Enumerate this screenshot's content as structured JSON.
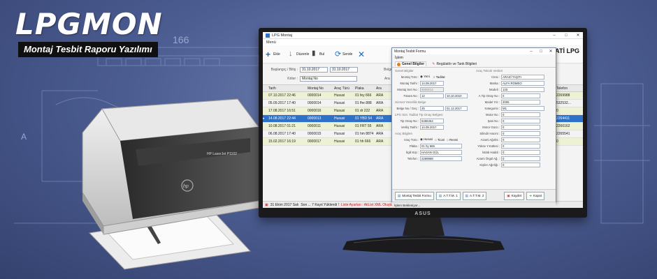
{
  "brand": {
    "title": "LPGMON",
    "subtitle": "Montaj Tesbit Raporu Yazılımı"
  },
  "blueprint": {
    "dimension_label": "166",
    "axis_letter": "A"
  },
  "printer": {
    "model_label": "HP LaserJet P1102",
    "brand_mark": "hp"
  },
  "monitor": {
    "brand_label": "ASUS"
  },
  "app": {
    "window_title": "LPG Montaj",
    "menu_label": "Menü",
    "toolbar": {
      "add_label": "Ekle",
      "edit_label": "Düzenle",
      "find_label": "Bul",
      "send_label": "Sende",
      "brand": "ATİ LPG"
    },
    "filters": {
      "date_label": "Başlangıç / Bitiş :",
      "date_start": "31.10.2017",
      "date_end": "31.10.2017",
      "criteria_label": "Kriter :",
      "criteria_value": "Montaj No",
      "doc_label": "Belge Tür",
      "search_label": "Ara"
    },
    "grid": {
      "headers": [
        "Tarih",
        "Montaj No",
        "Araç Türü",
        "Plaka",
        "Ara",
        "Telefon"
      ],
      "rows": [
        {
          "date": "07.10.2017 22:46",
          "no": "0000014",
          "type": "Hususi",
          "plate": "01 fey 666",
          "extra": "ARA",
          "phone": "2269988",
          "style": "alt"
        },
        {
          "date": "05.09.2017 17:40",
          "no": "0000014",
          "type": "Hususi",
          "plate": "01 fhe 888",
          "extra": "ARA",
          "phone": "532532...",
          "style": ""
        },
        {
          "date": "17.08.2017 16:51",
          "no": "0000016",
          "type": "Hususi",
          "plate": "01 dr 222",
          "extra": "ARA",
          "phone": "0",
          "style": "alt"
        },
        {
          "date": "14.08.2017 22:44",
          "no": "0000013",
          "type": "Hususi",
          "plate": "01 YBD 54",
          "extra": "ARA",
          "phone": "2264411",
          "style": "sel"
        },
        {
          "date": "10.08.2017 01:21",
          "no": "0000011",
          "type": "Hususi",
          "plate": "01 FRT 55",
          "extra": "ARA",
          "phone": "2266162",
          "style": "alt"
        },
        {
          "date": "06.08.2017 17:40",
          "no": "0000015",
          "type": "Hususi",
          "plate": "01 hm 8874",
          "extra": "ARA",
          "phone": "2265541",
          "style": ""
        },
        {
          "date": "15.02.2017 16:19",
          "no": "0000017",
          "type": "Hususi",
          "plate": "01 hh 666",
          "extra": "ARA",
          "phone": "0",
          "style": "alt"
        }
      ]
    },
    "status": {
      "date": "31 Ekim 2017 Salı",
      "records": "Son ... 7 Kayıt Yüklendi !",
      "warning": "Liste Ayarları : AtiList XML Oluşturuldu !"
    }
  },
  "dialog": {
    "title": "Montaj Tesbit Formu",
    "menu_label": "İşlem",
    "tabs": [
      "Genel Bilgiler",
      "Regülatör ve Tank Bilgileri"
    ],
    "general": {
      "group": "Genel Bilgiler",
      "montaj_turu_label": "Montaj Türü :",
      "montaj_turu_opt1": "Yeni",
      "montaj_turu_opt2": "Tadilat",
      "tarih_label": "Montaj Tarihi :",
      "tarih_value": "14.08.2017",
      "seri_no_label": "Montaj Seri No :",
      "seri_no_value": "0000014",
      "fatura_label": "Fatura No :",
      "fatura_value": "12",
      "fatura_date": "10.10.2010",
      "hizmet_group": "Hizmet Yeterlilik Belge",
      "belge_label": "Belge No / Geç :",
      "belge_value": "25",
      "belge_date": "01.12.2017",
      "tip_group": "LPG Sist. Tadilat Tip Onay Belgesi",
      "tip_label": "Tip Onay No :",
      "tip_value": "5456464",
      "verilis_label": "Veriliş Tarihi :",
      "verilis_value": "14.08.2017"
    },
    "vehicle": {
      "group": "Araç Bilgileri",
      "tur_label": "Araç Türü :",
      "tur_opts": [
        "Hususi",
        "Ticari",
        "Resmi"
      ],
      "plaka_label": "Plaka :",
      "plaka_value": "01 hy 666",
      "ilgili_label": "İlgili Kişi :",
      "ilgili_value": "HASAN GÜL",
      "telefon_label": "Telefon :",
      "telefon_value": "2269988"
    },
    "tech": {
      "group": "Araç Teknik Verileri",
      "rows": [
        {
          "label": "Cinsi :",
          "value": "ARAZİ TAŞITI"
        },
        {
          "label": "Marka :",
          "value": "ALFA ROMEO"
        },
        {
          "label": "Modeli :",
          "value": "133"
        },
        {
          "label": "A.Tip Onay No :",
          "value": "0"
        },
        {
          "label": "Model Yılı :",
          "value": "2006"
        },
        {
          "label": "Kategorisi :",
          "value": "M1"
        },
        {
          "label": "Motor No :",
          "value": "0"
        },
        {
          "label": "Şasi No :",
          "value": "0"
        },
        {
          "label": "Motor Gücü :",
          "value": "0"
        },
        {
          "label": "Silindir Hacmi :",
          "value": "0"
        },
        {
          "label": "Azami Ağırlık :",
          "value": "0"
        },
        {
          "label": "Yükse Y.Kütlesi :",
          "value": "0"
        },
        {
          "label": "İstiab Haddi :",
          "value": "0"
        },
        {
          "label": "Azami Örgül Ağ. :",
          "value": "0"
        },
        {
          "label": "Kişiler Ağırlığı :",
          "value": "0"
        }
      ]
    },
    "buttons": [
      "Montaj Tesbit Formu",
      "A.T.T.M. 1",
      "A.T.T.M. 2",
      "Kaydet",
      "Kapat"
    ],
    "status": "İşlem Bekleniyor..."
  }
}
